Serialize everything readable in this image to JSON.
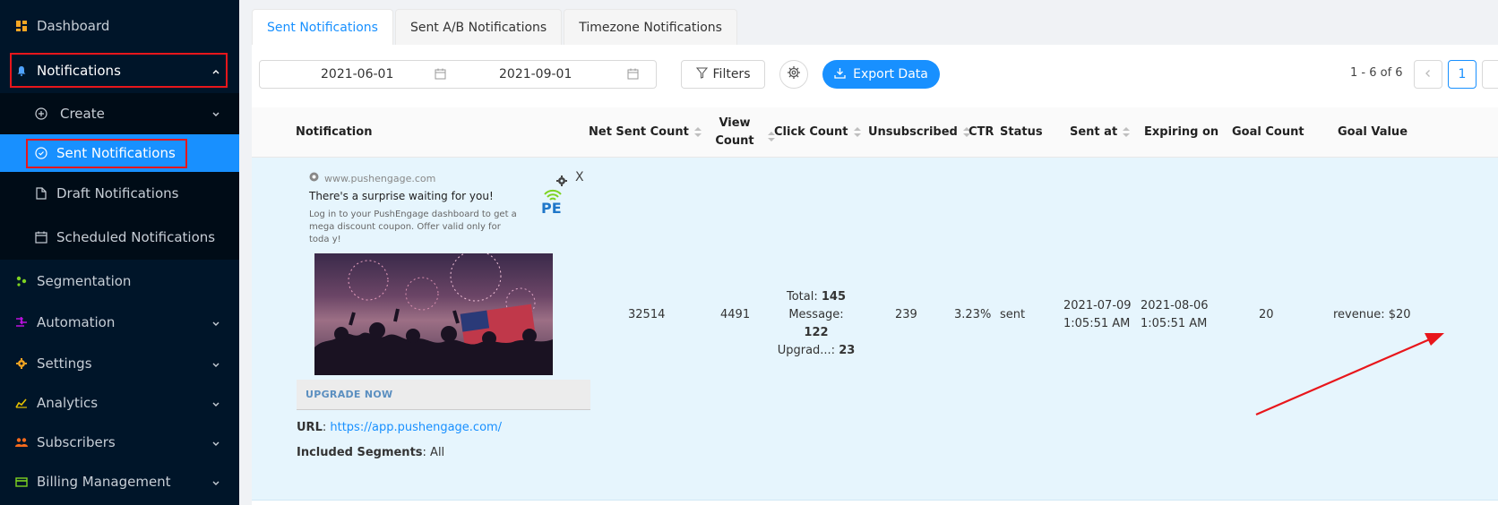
{
  "sidebar": {
    "items": [
      {
        "label": "Dashboard",
        "icon": "dashboard-icon"
      },
      {
        "label": "Notifications",
        "icon": "bell-icon"
      },
      {
        "label": "Create",
        "icon": "plus-circle-icon"
      },
      {
        "label": "Sent Notifications",
        "icon": "check-circle-icon"
      },
      {
        "label": "Draft Notifications",
        "icon": "file-icon"
      },
      {
        "label": "Scheduled Notifications",
        "icon": "calendar-icon"
      },
      {
        "label": "Segmentation",
        "icon": "segmentation-icon"
      },
      {
        "label": "Automation",
        "icon": "automation-icon"
      },
      {
        "label": "Settings",
        "icon": "gear-icon"
      },
      {
        "label": "Analytics",
        "icon": "analytics-icon"
      },
      {
        "label": "Subscribers",
        "icon": "users-icon"
      },
      {
        "label": "Billing Management",
        "icon": "billing-icon"
      }
    ]
  },
  "tabs": [
    "Sent Notifications",
    "Sent A/B Notifications",
    "Timezone Notifications"
  ],
  "toolbar": {
    "date_start": "2021-06-01",
    "date_end": "2021-09-01",
    "filters_label": "Filters",
    "export_label": "Export Data",
    "pagination_info": "1 - 6 of 6",
    "current_page": "1"
  },
  "columns": {
    "notification": "Notification",
    "net_sent": "Net Sent Count",
    "view_count": "View Count",
    "click_count": "Click Count",
    "unsubscribed": "Unsubscribed",
    "ctr": "CTR",
    "status": "Status",
    "sent_at": "Sent at",
    "expiring_on": "Expiring on",
    "goal_count": "Goal Count",
    "goal_value": "Goal Value"
  },
  "row": {
    "preview": {
      "site": "www.pushengage.com",
      "title": "There's a surprise waiting for you!",
      "body": "Log in to your PushEngage dashboard to get a mega discount coupon. Offer valid only for toda y!",
      "logo_text": "PE",
      "close_glyph": "X",
      "button": "UPGRADE NOW"
    },
    "url_label": "URL",
    "url": "https://app.pushengage.com/",
    "segments_label": "Included Segments",
    "segments": "All",
    "net_sent": "32514",
    "view_count": "4491",
    "click_total_label": "Total:",
    "click_total": "145",
    "click_message_label": "Message:",
    "click_message": "122",
    "click_upgrade_label": "Upgrad...:",
    "click_upgrade": "23",
    "unsubscribed": "239",
    "ctr": "3.23%",
    "status": "sent",
    "sent_at_date": "2021-07-09",
    "sent_at_time": "1:05:51 AM",
    "expiring_date": "2021-08-06",
    "expiring_time": "1:05:51 AM",
    "goal_count": "20",
    "goal_value": "revenue: $20"
  },
  "colors": {
    "sidebar_bg": "#001529",
    "accent": "#1890ff",
    "highlight_box": "#e8161b",
    "row_bg": "#e6f5fd"
  }
}
